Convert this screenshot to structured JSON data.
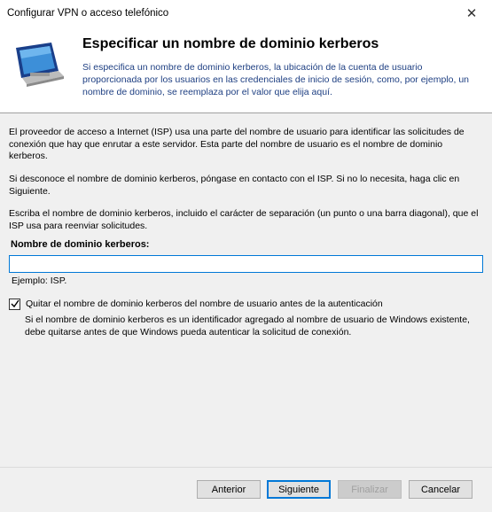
{
  "window": {
    "title": "Configurar VPN o acceso telefónico"
  },
  "header": {
    "title": "Especificar un nombre de dominio kerberos",
    "description": "Si especifica un nombre de dominio kerberos, la ubicación de la cuenta de usuario proporcionada por los usuarios en las credenciales de inicio de sesión, como, por ejemplo, un nombre de dominio, se reemplaza por el valor que elija aquí."
  },
  "body": {
    "para1": "El proveedor de acceso a Internet (ISP) usa una parte del nombre de usuario para identificar las solicitudes de conexión que hay que enrutar a este servidor. Esta parte del nombre de usuario es el nombre de dominio kerberos.",
    "para2": "Si desconoce el nombre de dominio kerberos, póngase en contacto con el ISP. Si no lo necesita, haga clic en Siguiente.",
    "para3": "Escriba el nombre de dominio kerberos, incluido el carácter de separación (un punto o una barra diagonal), que el ISP usa para reenviar solicitudes.",
    "field_label": "Nombre de dominio kerberos:",
    "field_value": "",
    "example": "Ejemplo: ISP.",
    "checkbox_label": "Quitar el nombre de dominio kerberos del nombre de usuario antes de la autenticación",
    "checkbox_checked": true,
    "checkbox_description": "Si el nombre de dominio kerberos es un identificador agregado al nombre de usuario de Windows existente, debe quitarse antes de que Windows pueda autenticar la solicitud de conexión."
  },
  "buttons": {
    "back": "Anterior",
    "next": "Siguiente",
    "finish": "Finalizar",
    "cancel": "Cancelar"
  },
  "close_glyph": "✕"
}
